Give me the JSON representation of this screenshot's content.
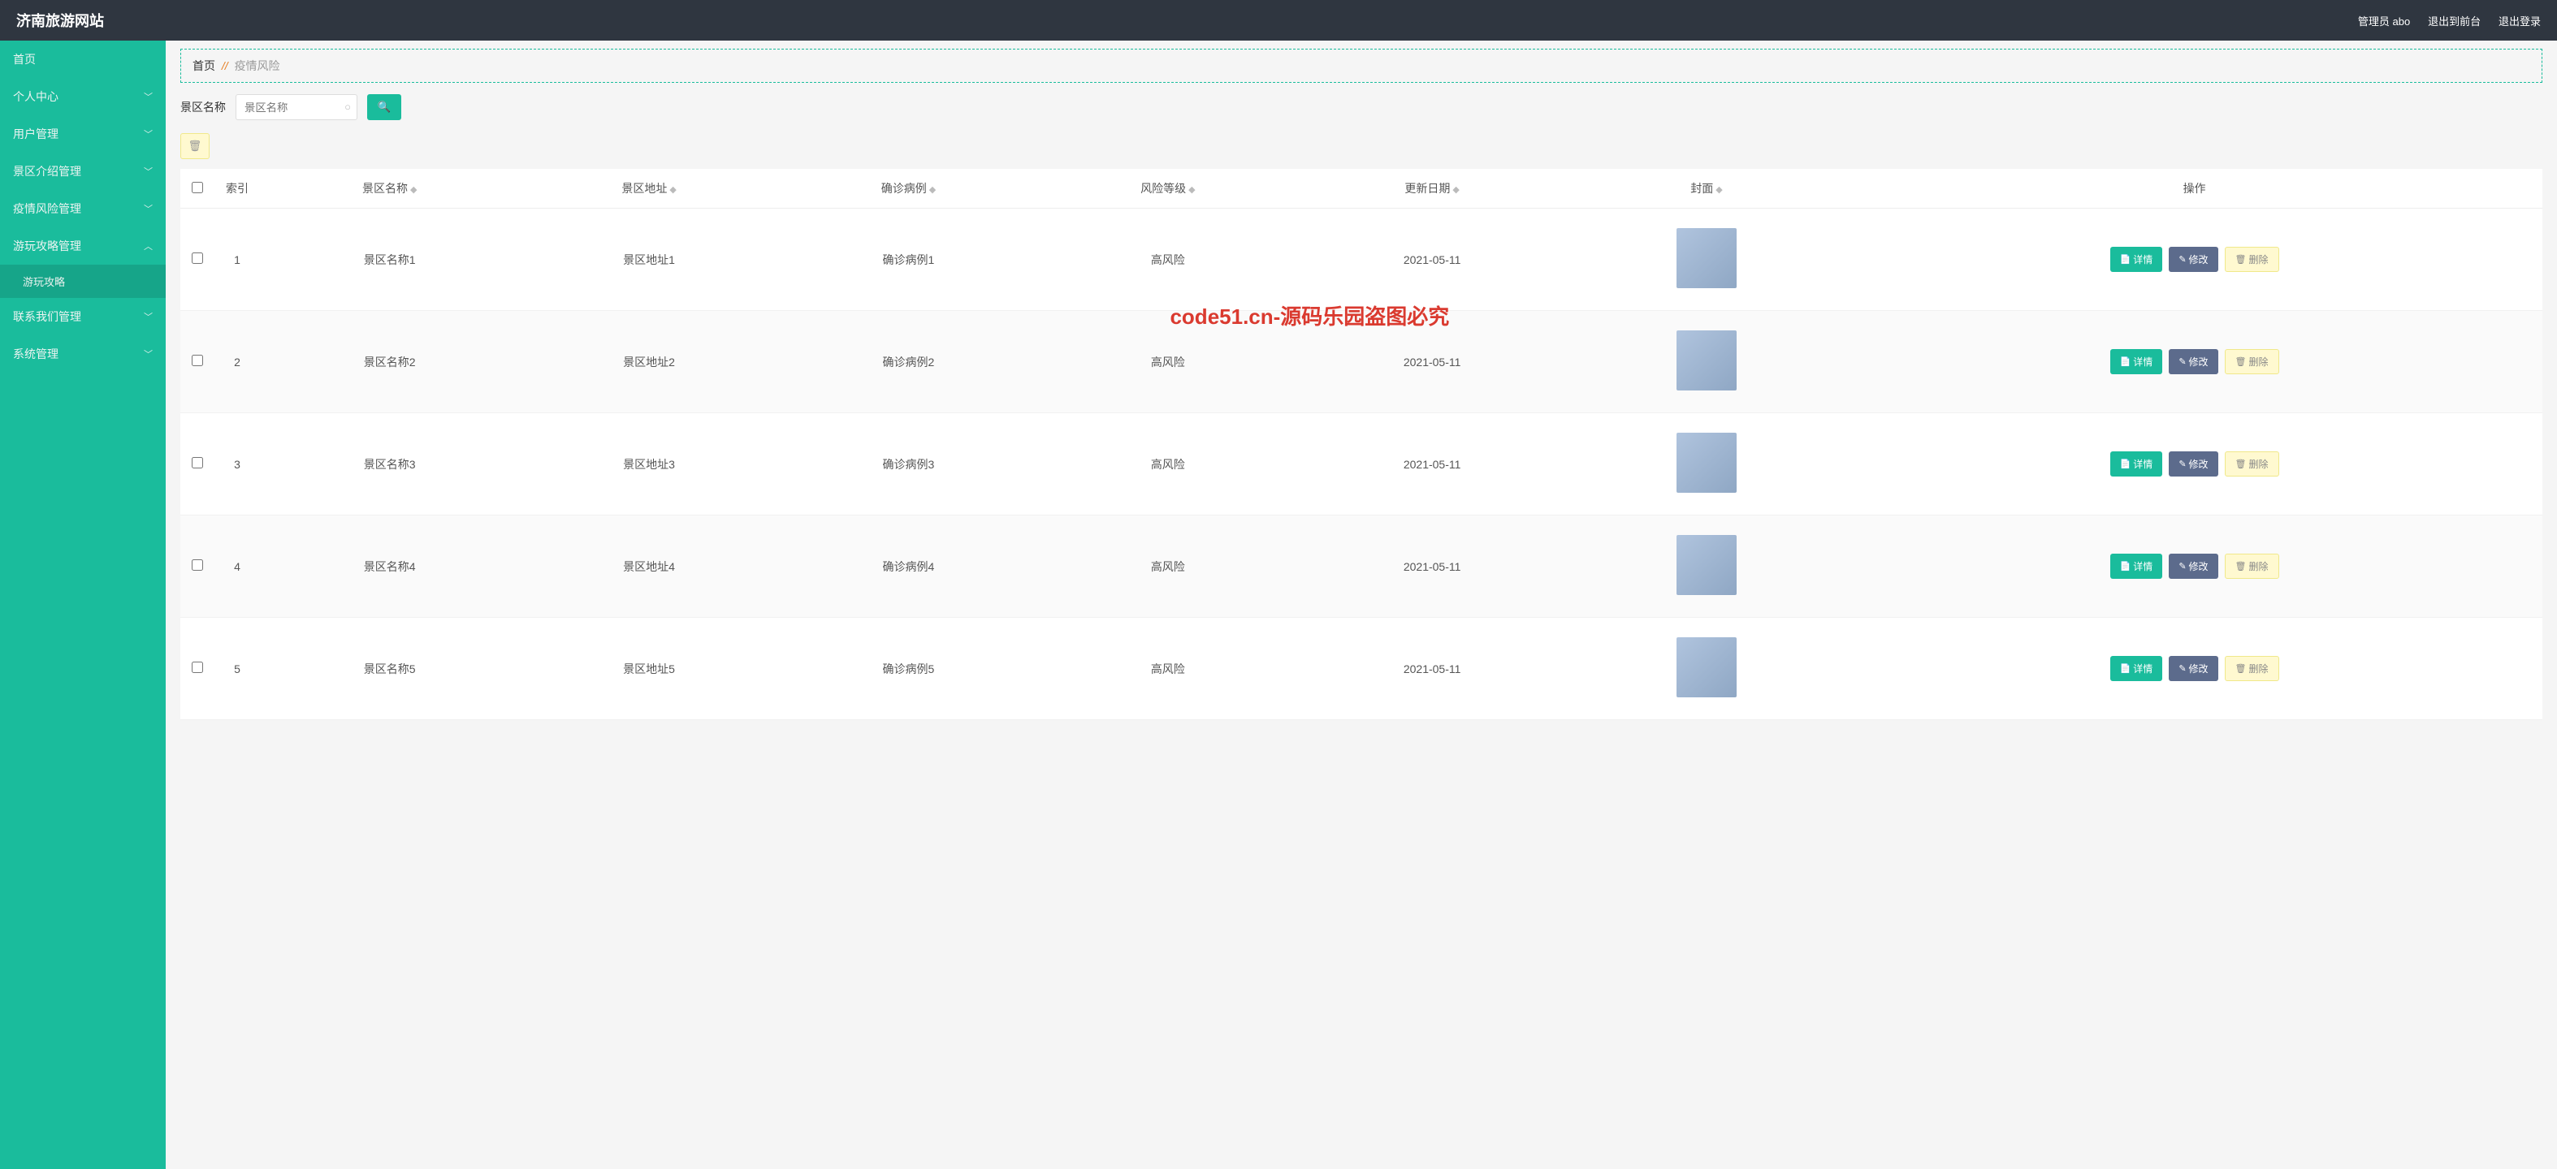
{
  "app": {
    "title": "济南旅游网站"
  },
  "top_right": {
    "admin_label": "管理员 abo",
    "front_link": "退出到前台",
    "logout_link": "退出登录"
  },
  "sidebar": {
    "home": "首页",
    "items": [
      {
        "label": "个人中心",
        "expanded": false
      },
      {
        "label": "用户管理",
        "expanded": false
      },
      {
        "label": "景区介绍管理",
        "expanded": false
      },
      {
        "label": "疫情风险管理",
        "expanded": false
      },
      {
        "label": "游玩攻略管理",
        "expanded": true
      },
      {
        "label": "联系我们管理",
        "expanded": false
      },
      {
        "label": "系统管理",
        "expanded": false
      }
    ],
    "sub_strategy": "游玩攻略"
  },
  "breadcrumb": {
    "home": "首页",
    "sep": "//",
    "current": "疫情风险"
  },
  "search": {
    "label": "景区名称",
    "placeholder": "景区名称",
    "value": ""
  },
  "table": {
    "headers": {
      "index": "索引",
      "name": "景区名称",
      "address": "景区地址",
      "cases": "确诊病例",
      "risk": "风险等级",
      "date": "更新日期",
      "cover": "封面",
      "ops": "操作"
    },
    "row_buttons": {
      "detail": "详情",
      "edit": "修改",
      "delete": "删除"
    },
    "rows": [
      {
        "idx": "1",
        "name": "景区名称1",
        "address": "景区地址1",
        "cases": "确诊病例1",
        "risk": "高风险",
        "date": "2021-05-11"
      },
      {
        "idx": "2",
        "name": "景区名称2",
        "address": "景区地址2",
        "cases": "确诊病例2",
        "risk": "高风险",
        "date": "2021-05-11"
      },
      {
        "idx": "3",
        "name": "景区名称3",
        "address": "景区地址3",
        "cases": "确诊病例3",
        "risk": "高风险",
        "date": "2021-05-11"
      },
      {
        "idx": "4",
        "name": "景区名称4",
        "address": "景区地址4",
        "cases": "确诊病例4",
        "risk": "高风险",
        "date": "2021-05-11"
      },
      {
        "idx": "5",
        "name": "景区名称5",
        "address": "景区地址5",
        "cases": "确诊病例5",
        "risk": "高风险",
        "date": "2021-05-11"
      }
    ]
  },
  "watermark": "code51.cn-源码乐园盗图必究"
}
